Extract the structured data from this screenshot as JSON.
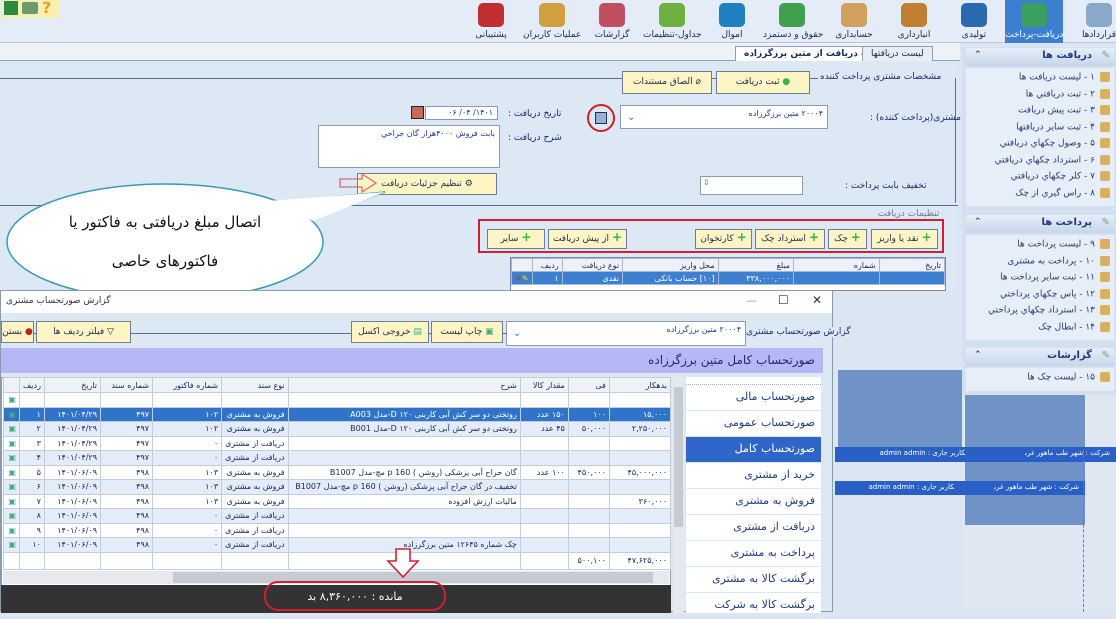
{
  "ribbon": {
    "items": [
      {
        "label": "قراردادها",
        "icon": "contract-icon",
        "color": "#8aa8c8"
      },
      {
        "label": "دریافت-پرداخت",
        "icon": "money-hand-icon",
        "color": "#3aa060",
        "selected": true
      },
      {
        "label": "تولیدی",
        "icon": "factory-icon",
        "color": "#2a6ab0"
      },
      {
        "label": "انبارداری",
        "icon": "box-icon",
        "color": "#c08030"
      },
      {
        "label": "حسابداری",
        "icon": "calculator-icon",
        "color": "#d0a060"
      },
      {
        "label": "حقوق و دستمزد",
        "icon": "salary-icon",
        "color": "#40a050"
      },
      {
        "label": "اموال",
        "icon": "monitor-icon",
        "color": "#2080c0"
      },
      {
        "label": "جداول-تنظیمات",
        "icon": "gear-icon",
        "color": "#70b040"
      },
      {
        "label": "گزارشات",
        "icon": "report-search-icon",
        "color": "#c05060"
      },
      {
        "label": "عملیات کاربران",
        "icon": "users-icon",
        "color": "#d0a040"
      },
      {
        "label": "پشتیبانی",
        "icon": "support-icon",
        "color": "#c03030"
      }
    ]
  },
  "tabs": [
    {
      "label": "لیست دریافتها"
    },
    {
      "label": "ثبت دریافت از متین برزگرزاده",
      "active": true
    }
  ],
  "sidebar": {
    "sections": [
      {
        "title": "دریافت ها",
        "items": [
          "۱ - لیست دریافت ها",
          "۲ - ثبت دریافتي ها",
          "۳ - ثبت پیش دریافت",
          "۴ - ثبت سایر دریافتها",
          "۵ - وصول چکهاي دریافتي",
          "۶ - استرداد چکهاي دریافتي",
          "۷ - کلر چکهاي دریافتي",
          "۸ - راس گیري از چک"
        ]
      },
      {
        "title": "پرداخت ها",
        "items": [
          "۹ - لیست پرداخت ها",
          "۱۰ - پرداخت به مشتری",
          "۱۱ - ثبت سایر پرداخت ها",
          "۱۲ - پاس چکهاي پرداختي",
          "۱۳ - استرداد چکهاي پرداختي",
          "۱۴ - ابطال چک"
        ]
      },
      {
        "title": "گزارشات",
        "items": [
          "۱۵ - لیست چک ها"
        ]
      }
    ]
  },
  "form": {
    "section_title": "مشخصات مشتری پرداخت کننده",
    "save_label": "ثبت دریافت",
    "attach_label": "الصاق مستندات",
    "customer_label": "مشتری(پرداخت کننده) :",
    "customer_value": "۲۰۰۰۴ متین برزگرزاده",
    "date_label": "تاریخ دریافت :",
    "date_value": "۱۴۰۱/ ۰۴/ ۰۶",
    "desc_label": "شرح دریافت :",
    "desc_value": "بابت فروش ۴۰۰۰هزار گان جراحي",
    "discount_label": "تخفیف بابت پرداخت :",
    "discount_value": "",
    "details_button": "تنظیم جزئیات دریافت",
    "settings_title": "تنظیمات دریافت",
    "add_buttons": [
      "نقد یا واریز",
      "چک",
      "استرداد چک",
      "کارتخوان",
      "از پیش دریافت",
      "سایر"
    ],
    "grid": {
      "columns": [
        "ردیف",
        "نوع دریافت",
        "محل واریز",
        "مبلغ",
        "شماره",
        "تاریخ"
      ],
      "rows": [
        [
          "۱",
          "نقدی",
          "[۱۰] حساب بانکی",
          "۳۳۸,۰۰۰,۰۰۰",
          "",
          ""
        ]
      ]
    }
  },
  "callout": {
    "text_line1": "اتصال مبلغ دریافتی به فاکتور یا",
    "text_line2": "فاکتورهای خاصی"
  },
  "report": {
    "window_title": "گزارش صورتحساب مشتری",
    "toolbar_label": "گزارش صورتحساب مشتری",
    "customer_value": "۲۰۰۰۴ متین برزگرزاده",
    "print_label": "چاپ لیست",
    "excel_label": "خروجی اکسل",
    "filter_label": "فیلتر ردیف ها",
    "close_label": "بستن",
    "header": "صورتحساب کامل متین برزگرزاده",
    "columns": [
      "ردیف",
      "تاریخ",
      "شماره سند",
      "شماره فاکتور",
      "نوع سند",
      "شرح",
      "مقدار کالا",
      "فی",
      "بدهکار"
    ],
    "rows": [
      [
        "۱",
        "۱۴۰۱/۰۴/۲۹",
        "۴۹۷",
        "۱۰۲",
        "فروش به مشتری",
        "روتختی دو سر کش آبی کاربنی ۱۲۰ D-مدل A003",
        "۱۵۰ عدد",
        "۱۰۰",
        "۱۵,۰۰۰"
      ],
      [
        "۲",
        "۱۴۰۱/۰۴/۲۹",
        "۴۹۷",
        "۱۰۲",
        "فروش به مشتری",
        "روتختی دو سر کش آبی کاربنی ۱۲۰ D-مدل B001",
        "۴۵ عدد",
        "۵۰,۰۰۰",
        "۲,۲۵۰,۰۰۰"
      ],
      [
        "۳",
        "۱۴۰۱/۰۴/۲۹",
        "۴۹۷",
        "۰",
        "دریافت از مشتری",
        "",
        "",
        "",
        ""
      ],
      [
        "۴",
        "۱۴۰۱/۰۴/۲۹",
        "۴۹۷",
        "۰",
        "دریافت از مشتری",
        "",
        "",
        "",
        ""
      ],
      [
        "۵",
        "۱۴۰۱/۰۶/۰۹",
        "۴۹۸",
        "۱۰۳",
        "فروش به مشتری",
        "گان جراح آبی پزشکی (روشن ) 160 p مچ-مدل B1007",
        "۱۰۰ عدد",
        "۴۵۰,۰۰۰",
        "۴۵,۰۰۰,۰۰۰"
      ],
      [
        "۶",
        "۱۴۰۱/۰۶/۰۹",
        "۴۹۸",
        "۱۰۳",
        "فروش به مشتری",
        "تخفیف در گان جراح آبی پزشکی (روشن ) 160 p مچ-مدل B1007",
        "",
        "",
        ""
      ],
      [
        "۷",
        "۱۴۰۱/۰۶/۰۹",
        "۴۹۸",
        "۱۰۳",
        "فروش به مشتری",
        "مالیات ارزش افزوده",
        "",
        "",
        "۳۶۰,۰۰۰"
      ],
      [
        "۸",
        "۱۴۰۱/۰۶/۰۹",
        "۴۹۸",
        "۰",
        "دریافت از مشتری",
        "",
        "",
        "",
        ""
      ],
      [
        "۹",
        "۱۴۰۱/۰۶/۰۹",
        "۴۹۸",
        "۰",
        "دریافت از مشتری",
        "",
        "",
        "",
        ""
      ],
      [
        "۱۰",
        "۱۴۰۱/۰۶/۰۹",
        "۴۹۸",
        "۰",
        "دریافت از مشتری",
        "چک شماره ۱۲۶۴۵ متین برزگرزاده",
        "",
        "",
        ""
      ]
    ],
    "totals": {
      "unit_price": "۵۰۰,۱۰۰",
      "debit": "۴۷,۶۲۵,۰۰۰"
    },
    "balance": "مانده : ۸,۳۶۰,۰۰۰ بد",
    "side_list": [
      "صورتحساب مالی",
      "صورتحساب عمومی",
      "صورتحساب کامل",
      "خرید از مشتری",
      "فروش به مشتری",
      "دریافت از مشتری",
      "پرداخت به مشتری",
      "برگشت کالا به مشتری",
      "برگشت کالا به شرکت"
    ],
    "side_selected": 2
  },
  "background": {
    "company": "شرکت : شهر طب ماهور غرب",
    "user": "کاربر جاری : admin admin",
    "row_number": "۱"
  }
}
